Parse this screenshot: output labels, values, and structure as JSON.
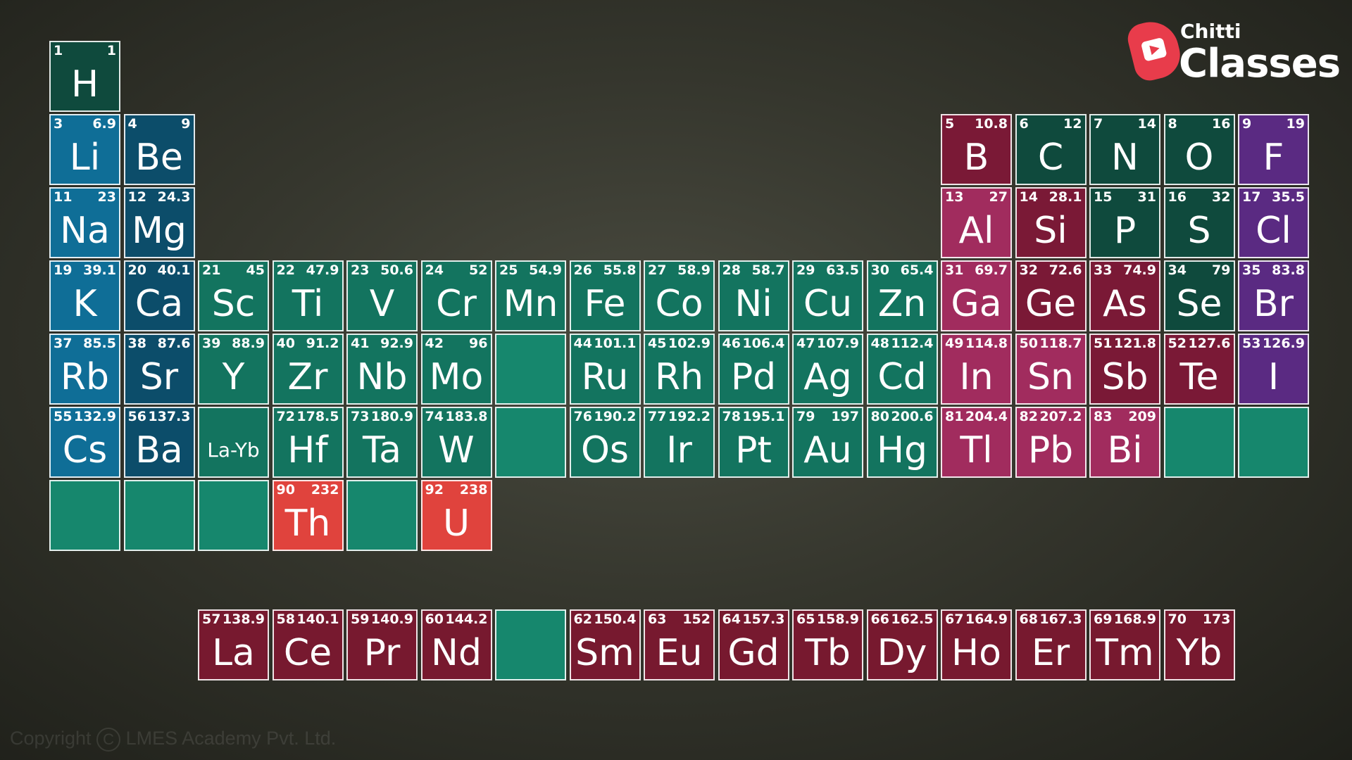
{
  "logo": {
    "small": "Chitti",
    "big": "Classes"
  },
  "copyright": {
    "symbol": "C",
    "text": "Copyright",
    "holder": "LMES Academy Pvt. Ltd."
  },
  "colors": {
    "alkali": "#0f6e97",
    "alkaline": "#0c4d6a",
    "nonmetal": "#0f4a3d",
    "transition": "#13745f",
    "metalloid": "#7a1936",
    "posttransition": "#a12c5e",
    "halogen": "#5a2a82",
    "actinide": "#e0433d",
    "lanthanide": "#77192f",
    "empty": "#16876d"
  },
  "elements": [
    {
      "n": "1",
      "m": "1",
      "s": "H",
      "c": "nonmetal",
      "r": 0,
      "col": 0
    },
    {
      "n": "3",
      "m": "6.9",
      "s": "Li",
      "c": "alkali",
      "r": 1,
      "col": 0
    },
    {
      "n": "4",
      "m": "9",
      "s": "Be",
      "c": "alkaline",
      "r": 1,
      "col": 1
    },
    {
      "n": "5",
      "m": "10.8",
      "s": "B",
      "c": "metalloid",
      "r": 1,
      "col": 12
    },
    {
      "n": "6",
      "m": "12",
      "s": "C",
      "c": "nonmetal",
      "r": 1,
      "col": 13
    },
    {
      "n": "7",
      "m": "14",
      "s": "N",
      "c": "nonmetal",
      "r": 1,
      "col": 14
    },
    {
      "n": "8",
      "m": "16",
      "s": "O",
      "c": "nonmetal",
      "r": 1,
      "col": 15
    },
    {
      "n": "9",
      "m": "19",
      "s": "F",
      "c": "halogen",
      "r": 1,
      "col": 16
    },
    {
      "n": "11",
      "m": "23",
      "s": "Na",
      "c": "alkali",
      "r": 2,
      "col": 0
    },
    {
      "n": "12",
      "m": "24.3",
      "s": "Mg",
      "c": "alkaline",
      "r": 2,
      "col": 1
    },
    {
      "n": "13",
      "m": "27",
      "s": "Al",
      "c": "posttransition",
      "r": 2,
      "col": 12
    },
    {
      "n": "14",
      "m": "28.1",
      "s": "Si",
      "c": "metalloid",
      "r": 2,
      "col": 13
    },
    {
      "n": "15",
      "m": "31",
      "s": "P",
      "c": "nonmetal",
      "r": 2,
      "col": 14
    },
    {
      "n": "16",
      "m": "32",
      "s": "S",
      "c": "nonmetal",
      "r": 2,
      "col": 15
    },
    {
      "n": "17",
      "m": "35.5",
      "s": "Cl",
      "c": "halogen",
      "r": 2,
      "col": 16
    },
    {
      "n": "19",
      "m": "39.1",
      "s": "K",
      "c": "alkali",
      "r": 3,
      "col": 0
    },
    {
      "n": "20",
      "m": "40.1",
      "s": "Ca",
      "c": "alkaline",
      "r": 3,
      "col": 1
    },
    {
      "n": "21",
      "m": "45",
      "s": "Sc",
      "c": "transition",
      "r": 3,
      "col": 2
    },
    {
      "n": "22",
      "m": "47.9",
      "s": "Ti",
      "c": "transition",
      "r": 3,
      "col": 3
    },
    {
      "n": "23",
      "m": "50.6",
      "s": "V",
      "c": "transition",
      "r": 3,
      "col": 4
    },
    {
      "n": "24",
      "m": "52",
      "s": "Cr",
      "c": "transition",
      "r": 3,
      "col": 5
    },
    {
      "n": "25",
      "m": "54.9",
      "s": "Mn",
      "c": "transition",
      "r": 3,
      "col": 6
    },
    {
      "n": "26",
      "m": "55.8",
      "s": "Fe",
      "c": "transition",
      "r": 3,
      "col": 7
    },
    {
      "n": "27",
      "m": "58.9",
      "s": "Co",
      "c": "transition",
      "r": 3,
      "col": 8
    },
    {
      "n": "28",
      "m": "58.7",
      "s": "Ni",
      "c": "transition",
      "r": 3,
      "col": 9
    },
    {
      "n": "29",
      "m": "63.5",
      "s": "Cu",
      "c": "transition",
      "r": 3,
      "col": 10
    },
    {
      "n": "30",
      "m": "65.4",
      "s": "Zn",
      "c": "transition",
      "r": 3,
      "col": 11
    },
    {
      "n": "31",
      "m": "69.7",
      "s": "Ga",
      "c": "posttransition",
      "r": 3,
      "col": 12
    },
    {
      "n": "32",
      "m": "72.6",
      "s": "Ge",
      "c": "metalloid",
      "r": 3,
      "col": 13
    },
    {
      "n": "33",
      "m": "74.9",
      "s": "As",
      "c": "metalloid",
      "r": 3,
      "col": 14
    },
    {
      "n": "34",
      "m": "79",
      "s": "Se",
      "c": "nonmetal",
      "r": 3,
      "col": 15
    },
    {
      "n": "35",
      "m": "83.8",
      "s": "Br",
      "c": "halogen",
      "r": 3,
      "col": 16
    },
    {
      "n": "37",
      "m": "85.5",
      "s": "Rb",
      "c": "alkali",
      "r": 4,
      "col": 0
    },
    {
      "n": "38",
      "m": "87.6",
      "s": "Sr",
      "c": "alkaline",
      "r": 4,
      "col": 1
    },
    {
      "n": "39",
      "m": "88.9",
      "s": "Y",
      "c": "transition",
      "r": 4,
      "col": 2
    },
    {
      "n": "40",
      "m": "91.2",
      "s": "Zr",
      "c": "transition",
      "r": 4,
      "col": 3
    },
    {
      "n": "41",
      "m": "92.9",
      "s": "Nb",
      "c": "transition",
      "r": 4,
      "col": 4
    },
    {
      "n": "42",
      "m": "96",
      "s": "Mo",
      "c": "transition",
      "r": 4,
      "col": 5
    },
    {
      "n": "",
      "m": "",
      "s": "",
      "c": "empty",
      "r": 4,
      "col": 6
    },
    {
      "n": "44",
      "m": "101.1",
      "s": "Ru",
      "c": "transition",
      "r": 4,
      "col": 7
    },
    {
      "n": "45",
      "m": "102.9",
      "s": "Rh",
      "c": "transition",
      "r": 4,
      "col": 8
    },
    {
      "n": "46",
      "m": "106.4",
      "s": "Pd",
      "c": "transition",
      "r": 4,
      "col": 9
    },
    {
      "n": "47",
      "m": "107.9",
      "s": "Ag",
      "c": "transition",
      "r": 4,
      "col": 10
    },
    {
      "n": "48",
      "m": "112.4",
      "s": "Cd",
      "c": "transition",
      "r": 4,
      "col": 11
    },
    {
      "n": "49",
      "m": "114.8",
      "s": "In",
      "c": "posttransition",
      "r": 4,
      "col": 12
    },
    {
      "n": "50",
      "m": "118.7",
      "s": "Sn",
      "c": "posttransition",
      "r": 4,
      "col": 13
    },
    {
      "n": "51",
      "m": "121.8",
      "s": "Sb",
      "c": "metalloid",
      "r": 4,
      "col": 14
    },
    {
      "n": "52",
      "m": "127.6",
      "s": "Te",
      "c": "metalloid",
      "r": 4,
      "col": 15
    },
    {
      "n": "53",
      "m": "126.9",
      "s": "I",
      "c": "halogen",
      "r": 4,
      "col": 16
    },
    {
      "n": "55",
      "m": "132.9",
      "s": "Cs",
      "c": "alkali",
      "r": 5,
      "col": 0
    },
    {
      "n": "56",
      "m": "137.3",
      "s": "Ba",
      "c": "alkaline",
      "r": 5,
      "col": 1
    },
    {
      "n": "",
      "m": "",
      "s": "La-Yb",
      "c": "transition",
      "r": 5,
      "col": 2,
      "small": true
    },
    {
      "n": "72",
      "m": "178.5",
      "s": "Hf",
      "c": "transition",
      "r": 5,
      "col": 3
    },
    {
      "n": "73",
      "m": "180.9",
      "s": "Ta",
      "c": "transition",
      "r": 5,
      "col": 4
    },
    {
      "n": "74",
      "m": "183.8",
      "s": "W",
      "c": "transition",
      "r": 5,
      "col": 5
    },
    {
      "n": "",
      "m": "",
      "s": "",
      "c": "empty",
      "r": 5,
      "col": 6
    },
    {
      "n": "76",
      "m": "190.2",
      "s": "Os",
      "c": "transition",
      "r": 5,
      "col": 7
    },
    {
      "n": "77",
      "m": "192.2",
      "s": "Ir",
      "c": "transition",
      "r": 5,
      "col": 8
    },
    {
      "n": "78",
      "m": "195.1",
      "s": "Pt",
      "c": "transition",
      "r": 5,
      "col": 9
    },
    {
      "n": "79",
      "m": "197",
      "s": "Au",
      "c": "transition",
      "r": 5,
      "col": 10
    },
    {
      "n": "80",
      "m": "200.6",
      "s": "Hg",
      "c": "transition",
      "r": 5,
      "col": 11
    },
    {
      "n": "81",
      "m": "204.4",
      "s": "Tl",
      "c": "posttransition",
      "r": 5,
      "col": 12
    },
    {
      "n": "82",
      "m": "207.2",
      "s": "Pb",
      "c": "posttransition",
      "r": 5,
      "col": 13
    },
    {
      "n": "83",
      "m": "209",
      "s": "Bi",
      "c": "posttransition",
      "r": 5,
      "col": 14
    },
    {
      "n": "",
      "m": "",
      "s": "",
      "c": "empty",
      "r": 5,
      "col": 15
    },
    {
      "n": "",
      "m": "",
      "s": "",
      "c": "empty",
      "r": 5,
      "col": 16
    },
    {
      "n": "",
      "m": "",
      "s": "",
      "c": "empty",
      "r": 6,
      "col": 0
    },
    {
      "n": "",
      "m": "",
      "s": "",
      "c": "empty",
      "r": 6,
      "col": 1
    },
    {
      "n": "",
      "m": "",
      "s": "",
      "c": "empty",
      "r": 6,
      "col": 2
    },
    {
      "n": "90",
      "m": "232",
      "s": "Th",
      "c": "actinide",
      "r": 6,
      "col": 3
    },
    {
      "n": "",
      "m": "",
      "s": "",
      "c": "empty",
      "r": 6,
      "col": 4
    },
    {
      "n": "92",
      "m": "238",
      "s": "U",
      "c": "actinide",
      "r": 6,
      "col": 5
    },
    {
      "n": "57",
      "m": "138.9",
      "s": "La",
      "c": "lanthanide",
      "r": 7,
      "col": 2
    },
    {
      "n": "58",
      "m": "140.1",
      "s": "Ce",
      "c": "lanthanide",
      "r": 7,
      "col": 3
    },
    {
      "n": "59",
      "m": "140.9",
      "s": "Pr",
      "c": "lanthanide",
      "r": 7,
      "col": 4
    },
    {
      "n": "60",
      "m": "144.2",
      "s": "Nd",
      "c": "lanthanide",
      "r": 7,
      "col": 5
    },
    {
      "n": "",
      "m": "",
      "s": "",
      "c": "empty",
      "r": 7,
      "col": 6
    },
    {
      "n": "62",
      "m": "150.4",
      "s": "Sm",
      "c": "lanthanide",
      "r": 7,
      "col": 7
    },
    {
      "n": "63",
      "m": "152",
      "s": "Eu",
      "c": "lanthanide",
      "r": 7,
      "col": 8
    },
    {
      "n": "64",
      "m": "157.3",
      "s": "Gd",
      "c": "lanthanide",
      "r": 7,
      "col": 9
    },
    {
      "n": "65",
      "m": "158.9",
      "s": "Tb",
      "c": "lanthanide",
      "r": 7,
      "col": 10
    },
    {
      "n": "66",
      "m": "162.5",
      "s": "Dy",
      "c": "lanthanide",
      "r": 7,
      "col": 11
    },
    {
      "n": "67",
      "m": "164.9",
      "s": "Ho",
      "c": "lanthanide",
      "r": 7,
      "col": 12
    },
    {
      "n": "68",
      "m": "167.3",
      "s": "Er",
      "c": "lanthanide",
      "r": 7,
      "col": 13
    },
    {
      "n": "69",
      "m": "168.9",
      "s": "Tm",
      "c": "lanthanide",
      "r": 7,
      "col": 14
    },
    {
      "n": "70",
      "m": "173",
      "s": "Yb",
      "c": "lanthanide",
      "r": 7,
      "col": 15
    }
  ]
}
